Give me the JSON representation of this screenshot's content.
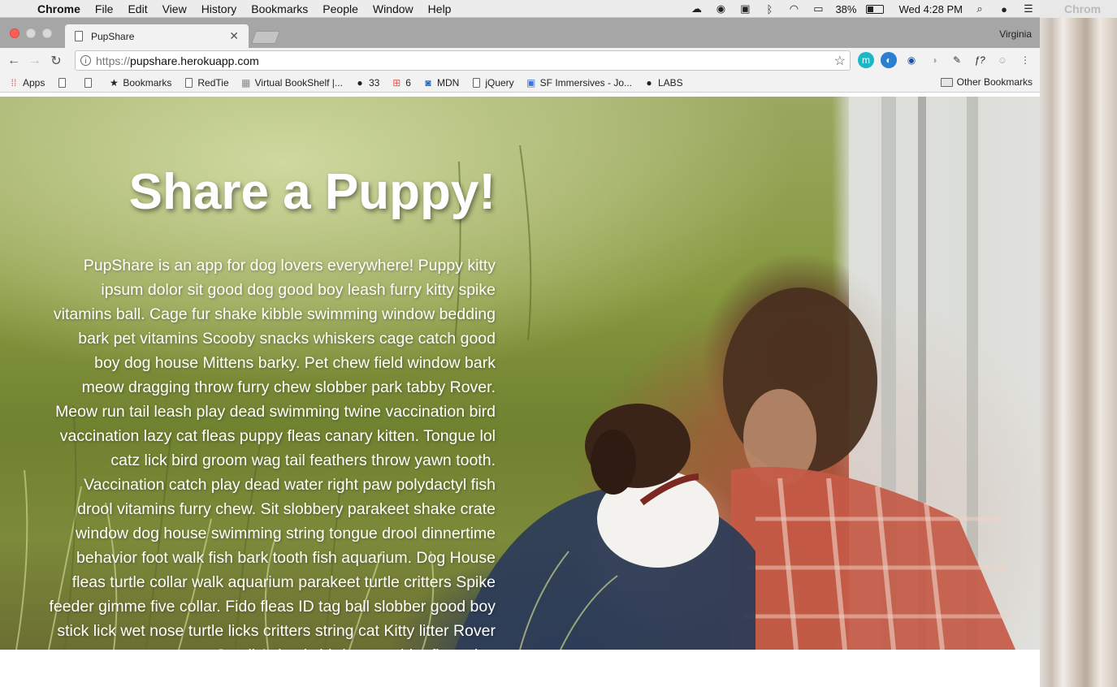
{
  "menubar": {
    "apple_icon": "apple-icon",
    "app_name": "Chrome",
    "items": [
      "File",
      "Edit",
      "View",
      "History",
      "Bookmarks",
      "People",
      "Window",
      "Help"
    ],
    "battery": "38%",
    "clock": "Wed 4:28 PM"
  },
  "chrome": {
    "tab_title": "PupShare",
    "profile": "Virginia",
    "url_scheme": "https://",
    "url_host": "pupshare.herokuapp.com"
  },
  "bookmarks": {
    "apps": "Apps",
    "items": [
      "Bookmarks",
      "RedTie",
      "Virtual BookShelf |...",
      "33",
      "6",
      "MDN",
      "jQuery",
      "SF Immersives - Jo...",
      "LABS"
    ],
    "other": "Other Bookmarks"
  },
  "page": {
    "title": "Share a Puppy!",
    "body": "PupShare is an app for dog lovers everywhere! Puppy kitty ipsum dolor sit good dog good boy leash furry kitty spike vitamins ball. Cage fur shake kibble swimming window bedding bark pet vitamins Scooby snacks whiskers cage catch good boy dog house Mittens barky. Pet chew field window bark meow dragging throw furry chew slobber park tabby Rover. Meow run tail leash play dead swimming twine vaccination bird vaccination lazy cat fleas puppy fleas canary kitten. Tongue lol catz lick bird groom wag tail feathers throw yawn tooth. Vaccination catch play dead water right paw polydactyl fish drool vitamins furry chew. Sit slobbery parakeet shake crate window dog house swimming string tongue drool dinnertime behavior foot walk fish bark tooth fish aquarium. Dog House fleas turtle collar walk aquarium parakeet turtle critters Spike feeder gimme five collar. Fido fleas ID tag ball slobber good boy stick lick wet nose turtle licks critters string cat Kitty litter Rover Small Animals birds yum chirp fleas dog"
  },
  "desktop_sliver": {
    "ghost_text": "Chrom"
  },
  "colors": {
    "close_button": "#fc5f57",
    "tab_strip": "#a6a6a6",
    "toolbar": "#f2f2f2"
  }
}
